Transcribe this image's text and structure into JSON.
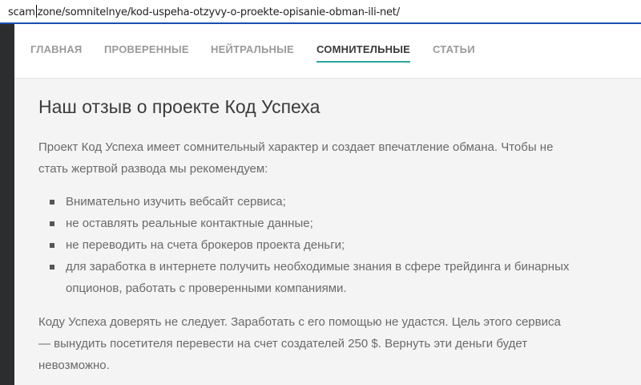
{
  "address_bar": {
    "url_before_caret": "scam",
    "url_after_caret": "zone/somnitelnye/kod-uspeha-otzyvy-o-proekte-opisanie-obman-ili-net/"
  },
  "nav": {
    "items": [
      {
        "label": "ГЛАВНАЯ",
        "active": false
      },
      {
        "label": "ПРОВЕРЕННЫЕ",
        "active": false
      },
      {
        "label": "НЕЙТРАЛЬНЫЕ",
        "active": false
      },
      {
        "label": "СОМНИТЕЛЬНЫЕ",
        "active": true
      },
      {
        "label": "СТАТЬИ",
        "active": false
      }
    ]
  },
  "article": {
    "title": "Наш отзыв о проекте Код Успеха",
    "intro_line1": "Проект Код Успеха имеет сомнительный характер и создает впечатление обмана. Чтобы не",
    "intro_line2": "стать жертвой развода мы рекомендуем:",
    "recommendations": [
      "Внимательно изучить вебсайт сервиса;",
      "не оставлять реальные контактные данные;",
      "не переводить на счета брокеров проекта деньги;",
      "для заработка в интернете получить необходимые знания в сфере трейдинга и бинарных",
      "опционов, работать с проверенными компаниями."
    ],
    "conclusion_line1": "Коду Успеха доверять не следует. Заработать с его помощью не удастся. Цель этого сервиса",
    "conclusion_line2": "— вынудить посетителя перевести на счет создателей 250 $. Вернуть эти деньги будет",
    "conclusion_line3": "невозможно."
  },
  "colors": {
    "accent": "#2aa7a0",
    "address_bar_underline": "#1b4fb0",
    "sidebar_strip": "#2b2d2f",
    "page_background": "#f4f4f4"
  }
}
